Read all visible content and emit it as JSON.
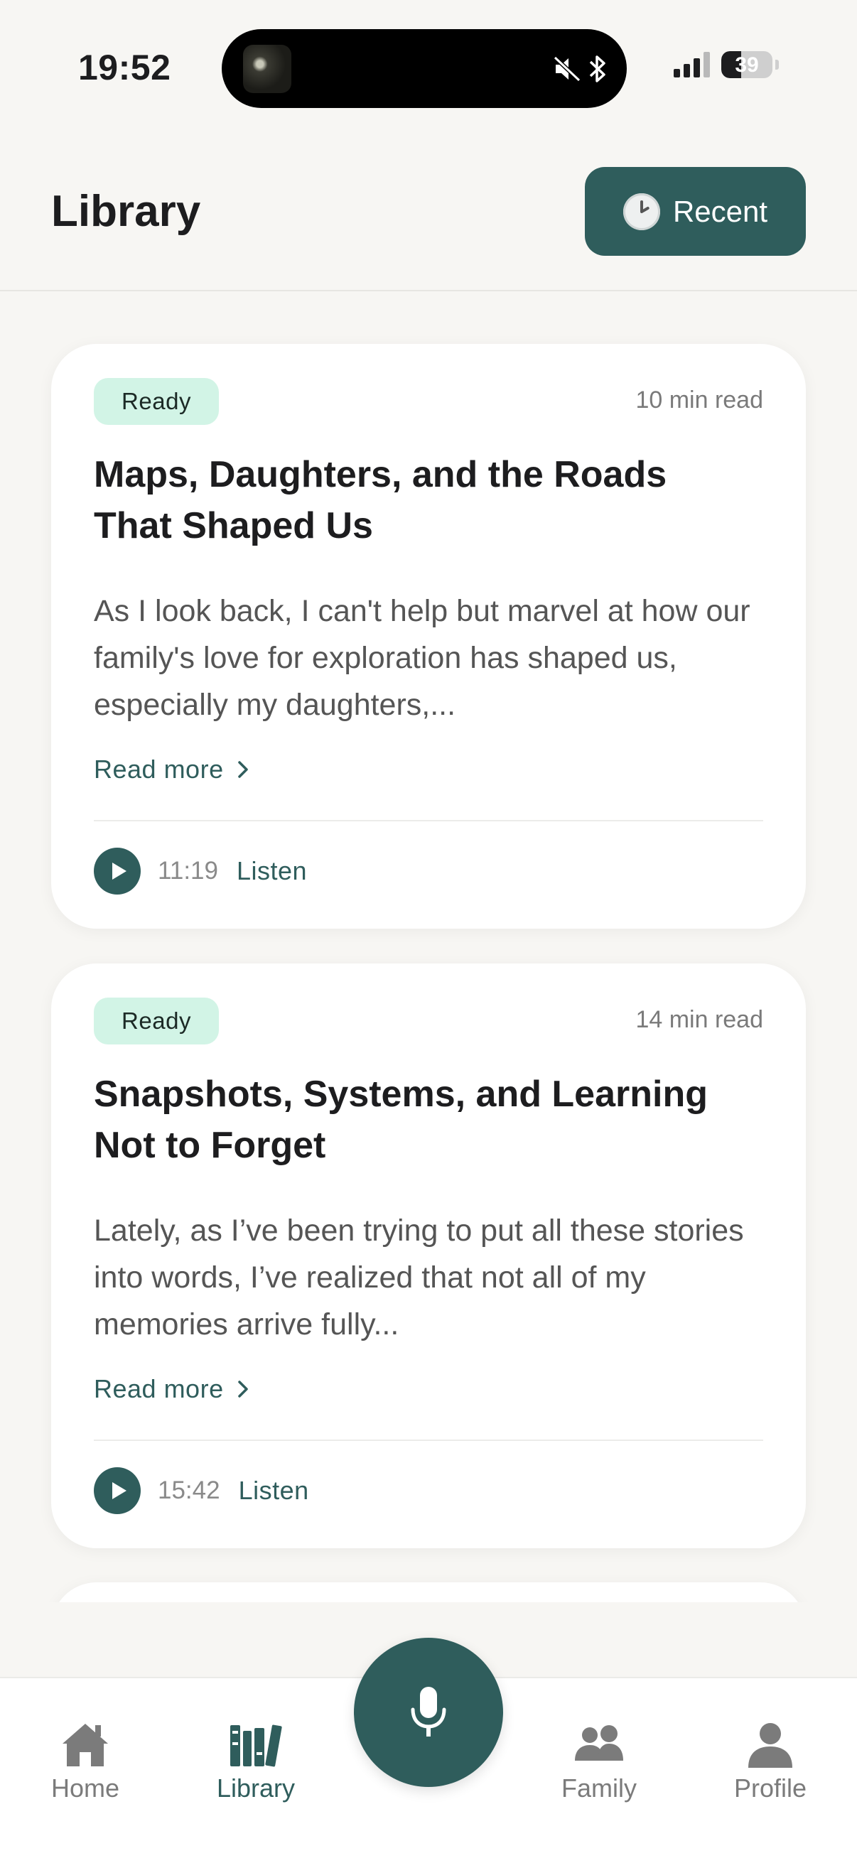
{
  "status_bar": {
    "time": "19:52",
    "battery": "39",
    "battery_level": 0.39
  },
  "header": {
    "title": "Library",
    "recent_label": "Recent"
  },
  "stories": [
    {
      "status": "Ready",
      "read_time": "10 min read",
      "title": "Maps, Daughters, and the Roads That Shaped Us",
      "excerpt": "As I look back, I can't help but marvel at how our family's love for exploration has shaped us, especially my daughters,...",
      "read_more": "Read more",
      "duration": "11:19",
      "listen": "Listen"
    },
    {
      "status": "Ready",
      "read_time": "14 min read",
      "title": "Snapshots, Systems, and Learning Not to Forget",
      "excerpt": "Lately, as I’ve been trying to put all these stories into words, I’ve realized that not all of my memories arrive fully...",
      "read_more": "Read more",
      "duration": "15:42",
      "listen": "Listen"
    }
  ],
  "tab_bar": {
    "home": "Home",
    "library": "Library",
    "family": "Family",
    "profile": "Profile",
    "active": "library"
  },
  "colors": {
    "accent": "#2f5d5c",
    "badge_bg": "#d2f4e6",
    "background": "#f7f6f3"
  }
}
